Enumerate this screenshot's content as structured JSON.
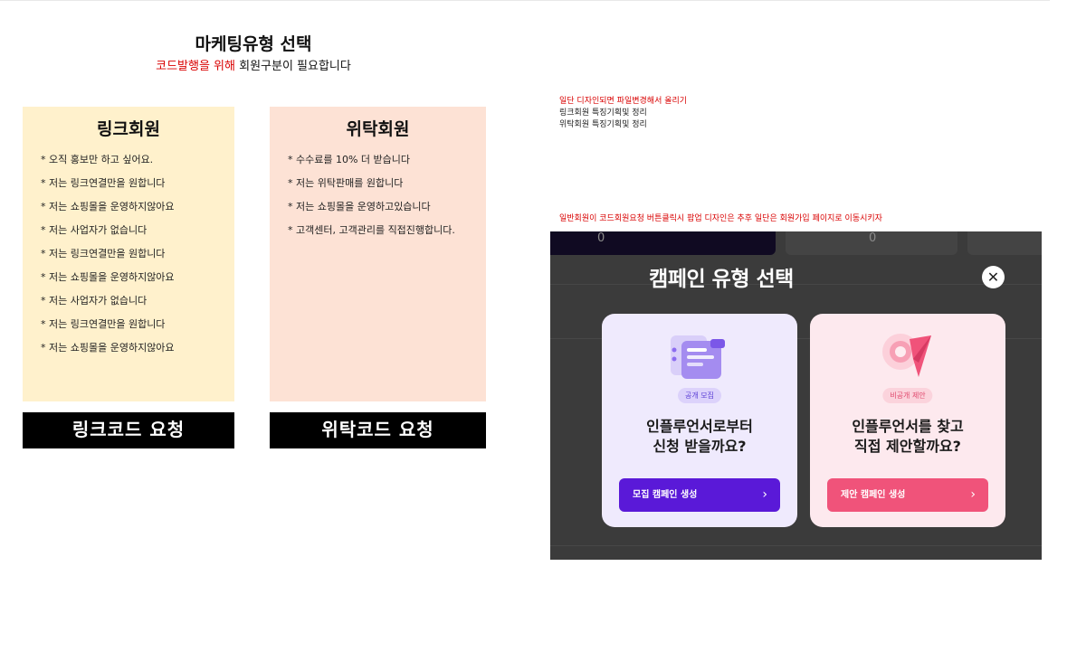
{
  "header": {
    "title": "마케팅유형 선택",
    "subtitle_red": "코드발행을 위해",
    "subtitle_rest": " 회원구분이 필요합니다"
  },
  "link_member": {
    "title": "링크회원",
    "items": [
      "* 오직 홍보만 하고 싶어요.",
      "* 저는 링크연결만을 원합니다",
      "* 저는 쇼핑몰을 운영하지않아요",
      "* 저는 사업자가 없습니다",
      "* 저는 링크연결만을 원합니다",
      "* 저는 쇼핑몰을 운영하지않아요",
      "* 저는 사업자가 없습니다",
      "* 저는 링크연결만을 원합니다",
      "* 저는 쇼핑몰을 운영하지않아요"
    ],
    "button": "링크코드 요청"
  },
  "consign_member": {
    "title": "위탁회원",
    "items": [
      "* 수수료를 10% 더 받습니다",
      "* 저는 위탁판매를 원합니다",
      "* 저는 쇼핑몰을 운영하고있습니다",
      "* 고객센터, 고객관리를 직접진행합니다."
    ],
    "button": "위탁코드 요청"
  },
  "notes": {
    "line1": "일단 디자인되면 파일변경해서 올리기",
    "line2": "링크회원 특징기획및 정리",
    "line3": "위탁회원 특징기획및 정리",
    "line4": "일반회원이 코드회원요청 버튼클릭시 팝업 디자인은 추후 일단은 회원가입 페이지로 이동시키자"
  },
  "modal": {
    "bg_num_1": "0",
    "bg_num_2": "0",
    "title": "캠페인 유형 선택",
    "close": "✕",
    "recruit": {
      "badge": "공개 모집",
      "question_1": "인플루언서로부터",
      "question_2": "신청 받을까요?",
      "button": "모집 캠페인 생성"
    },
    "propose": {
      "badge": "비공개 제안",
      "question_1": "인플루언서를 찾고",
      "question_2": "직접 제안할까요?",
      "button": "제안 캠페인 생성"
    },
    "chevron": "›"
  },
  "colors": {
    "link_card_bg": "#fff1cc",
    "consign_card_bg": "#fde2d5",
    "recruit_accent": "#5a19d8",
    "propose_accent": "#f0537a",
    "note_red": "#d90000"
  },
  "icons": {
    "recruit": "document-list-illustration",
    "propose": "paper-plane-illustration",
    "close": "close-icon",
    "chevron": "chevron-right-icon"
  }
}
